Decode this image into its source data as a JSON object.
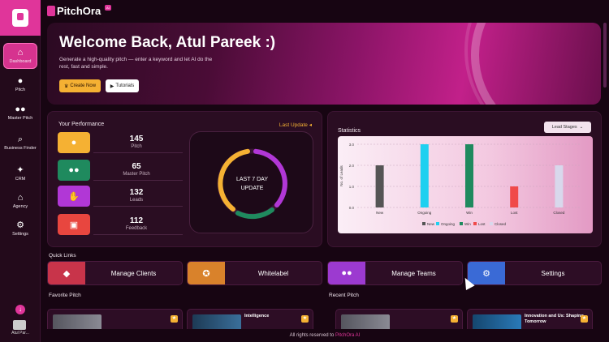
{
  "app": {
    "name": "PitchOra",
    "badge": "AI"
  },
  "sidebar": {
    "items": [
      {
        "label": "Dashboard",
        "icon": "home-icon",
        "glyph": "⌂"
      },
      {
        "label": "Pitch",
        "icon": "user-icon",
        "glyph": "👤"
      },
      {
        "label": "Master Pitch",
        "icon": "users-icon",
        "glyph": "👥"
      },
      {
        "label": "Business Finder",
        "icon": "search-icon",
        "glyph": "🔍"
      },
      {
        "label": "CRM",
        "icon": "crm-icon",
        "glyph": "⚙"
      },
      {
        "label": "Agency",
        "icon": "building-icon",
        "glyph": "🏛"
      },
      {
        "label": "Settings",
        "icon": "gear-icon",
        "glyph": "⚙"
      }
    ],
    "user_name": "Atul Par..."
  },
  "hero": {
    "title": "Welcome Back, Atul Pareek :)",
    "subtitle": "Generate a high-quality pitch — enter a keyword and let AI do the rest, fast and simple.",
    "create_label": "Create Now",
    "tutorials_label": "Tutorials"
  },
  "performance": {
    "title": "Your Performance",
    "last_update": "Last Update",
    "stats": [
      {
        "value": "145",
        "label": "Pitch",
        "color": "#f5b133"
      },
      {
        "value": "65",
        "label": "Master Pitch",
        "color": "#1f8a5e"
      },
      {
        "value": "132",
        "label": "Leads",
        "color": "#b137d6"
      },
      {
        "value": "112",
        "label": "Feedback",
        "color": "#e8463f"
      }
    ],
    "ring_line1": "LAST 7 DAY",
    "ring_line2": "UPDATE"
  },
  "statistics": {
    "title": "Statistics",
    "dropdown": "Lead Stages"
  },
  "chart_data": {
    "type": "bar",
    "categories": [
      "New",
      "Ongoing",
      "Win",
      "Lost",
      "Closed"
    ],
    "values": [
      2,
      3,
      3,
      1,
      2
    ],
    "colors": [
      "#555555",
      "#1fd0f0",
      "#1f8a5e",
      "#f04a4a",
      "#d8d8ec"
    ],
    "ylabel": "No. of Leads",
    "yticks": [
      "0.0",
      "1.0",
      "2.0",
      "3.0"
    ],
    "ylim": [
      0,
      3
    ],
    "legend": [
      "New",
      "Ongoing",
      "Win",
      "Lost",
      "Closed"
    ],
    "legend_position": "bottom",
    "grid": true
  },
  "quick_links": {
    "title": "Quick Links",
    "items": [
      {
        "label": "Manage Clients",
        "color": "#c8344a"
      },
      {
        "label": "Whitelabel",
        "color": "#d9822b"
      },
      {
        "label": "Manage Teams",
        "color": "#9c3ad0"
      },
      {
        "label": "Settings",
        "color": "#3a6ad6"
      }
    ]
  },
  "favorite_pitch": {
    "title": "Favorite Pitch"
  },
  "recent_pitch": {
    "title": "Recent Pitch",
    "cards": [
      {
        "title": "",
        "img": "#6b6b74"
      },
      {
        "title": "Intelligence",
        "img": "#2a4c6a"
      },
      {
        "title": "",
        "img": "#6b6b74"
      },
      {
        "title": "Innovation and Us: Shaping Tomorrow",
        "img": "#1e5a8a"
      }
    ]
  },
  "footer": {
    "text": "All rights reserved to",
    "brand": "PitchOra AI"
  }
}
